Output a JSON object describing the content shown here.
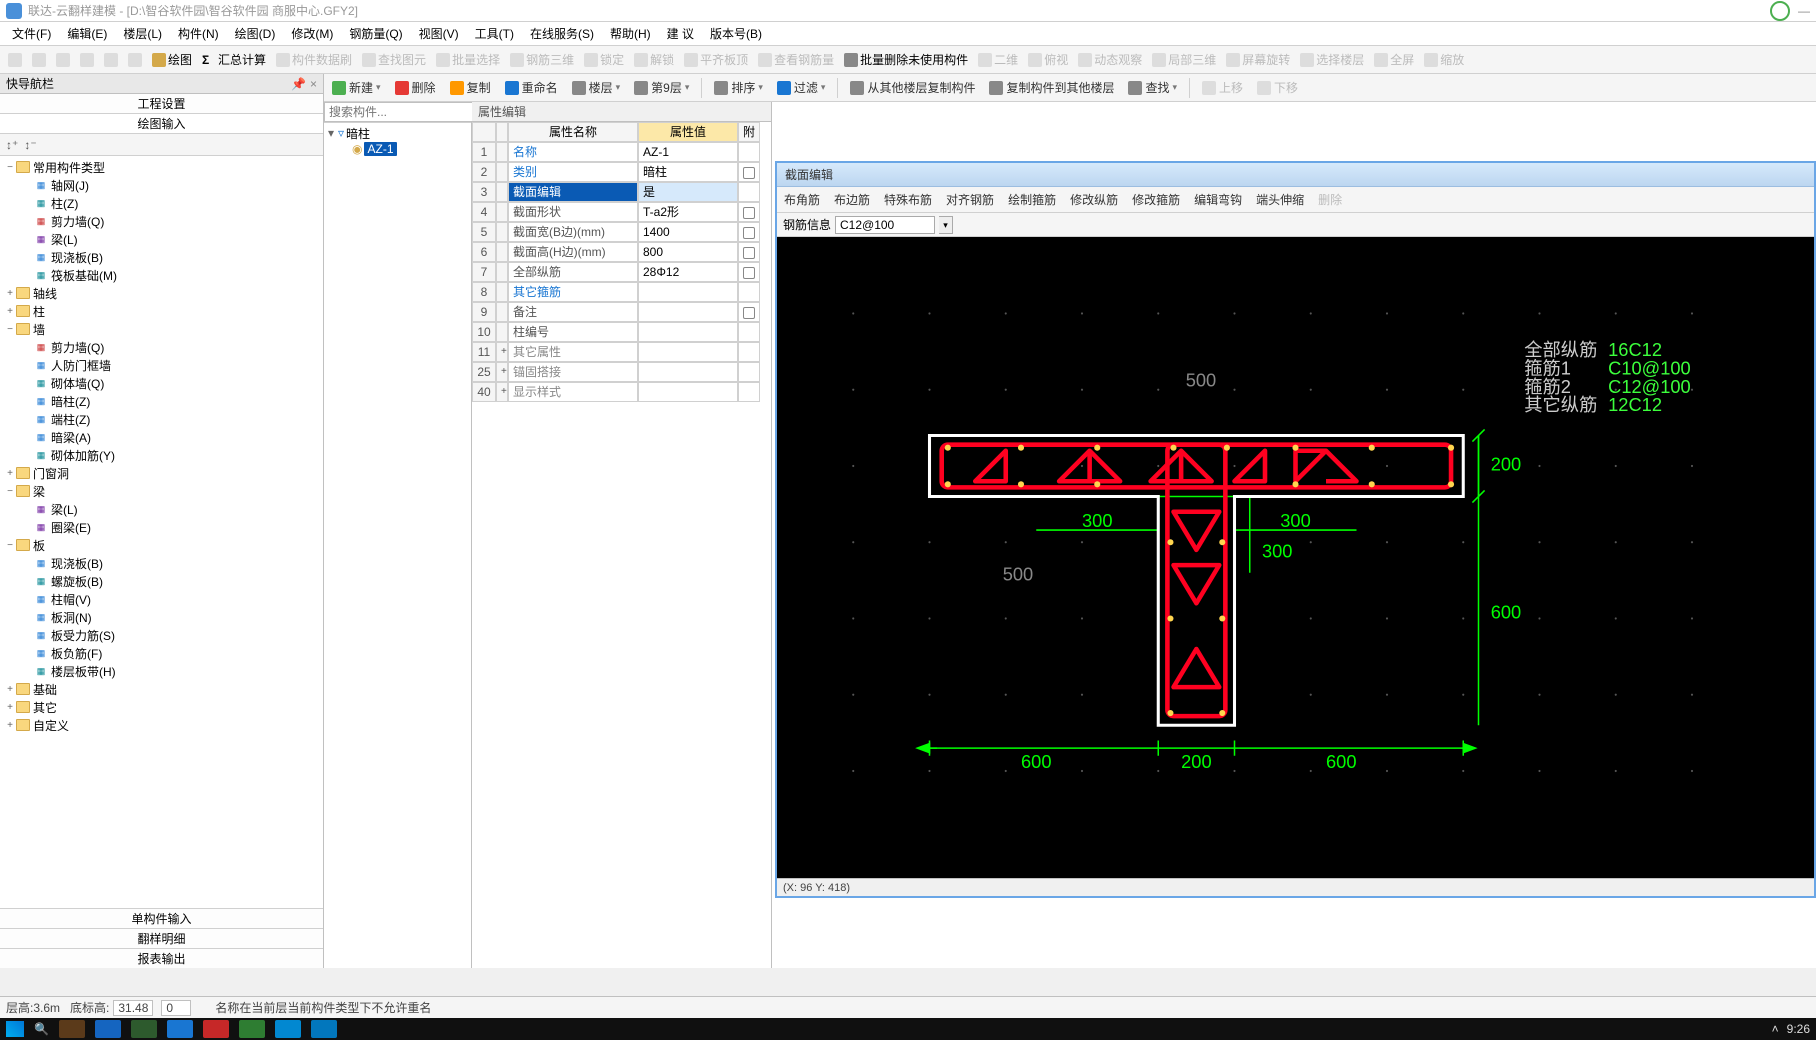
{
  "titlebar": {
    "text": "联达-云翻样建模 - [D:\\智谷软件园\\智谷软件园 商服中心.GFY2]"
  },
  "menu": [
    "文件(F)",
    "编辑(E)",
    "楼层(L)",
    "构件(N)",
    "绘图(D)",
    "修改(M)",
    "钢筋量(Q)",
    "视图(V)",
    "工具(T)",
    "在线服务(S)",
    "帮助(H)",
    "建 议",
    "版本号(B)"
  ],
  "toolbar": [
    {
      "l": "",
      "disabled": true
    },
    {
      "l": "",
      "disabled": true
    },
    {
      "l": "",
      "disabled": true
    },
    {
      "l": "",
      "disabled": true
    },
    {
      "l": "",
      "disabled": true
    },
    {
      "l": "",
      "disabled": true
    },
    {
      "l": "绘图",
      "bold": true,
      "icon": "pencil"
    },
    {
      "l": "汇总计算",
      "bold": true,
      "icon": "sigma"
    },
    {
      "l": "构件数据刷",
      "disabled": true
    },
    {
      "l": "查找图元",
      "disabled": true
    },
    {
      "l": "批量选择",
      "disabled": true
    },
    {
      "l": "钢筋三维",
      "disabled": true
    },
    {
      "l": "锁定",
      "disabled": true
    },
    {
      "l": "解锁",
      "disabled": true
    },
    {
      "l": "平齐板顶",
      "disabled": true
    },
    {
      "l": "查看钢筋量",
      "disabled": true
    },
    {
      "l": "批量删除未使用构件",
      "bold": true
    },
    {
      "l": "二维",
      "disabled": true
    },
    {
      "l": "俯视",
      "disabled": true
    },
    {
      "l": "动态观察",
      "disabled": true
    },
    {
      "l": "局部三维",
      "disabled": true
    },
    {
      "l": "屏幕旋转",
      "disabled": true
    },
    {
      "l": "选择楼层",
      "disabled": true
    },
    {
      "l": "全屏",
      "disabled": true
    },
    {
      "l": "缩放",
      "disabled": true
    }
  ],
  "subtoolbar": {
    "items": [
      "新建",
      "删除",
      "复制",
      "重命名",
      "楼层",
      "第9层",
      "",
      "排序",
      "过滤",
      "",
      "从其他楼层复制构件",
      "复制构件到其他楼层",
      "查找"
    ],
    "disabled": [
      "上移",
      "下移"
    ]
  },
  "left": {
    "nav_title": "快导航栏",
    "tab1": "工程设置",
    "tab2": "绘图输入",
    "tree": [
      {
        "d": 0,
        "t": "folder",
        "tw": "−",
        "l": "常用构件类型"
      },
      {
        "d": 1,
        "t": "node",
        "ic": "ic-blue",
        "l": "轴网(J)"
      },
      {
        "d": 1,
        "t": "node",
        "ic": "ic-teal",
        "l": "柱(Z)"
      },
      {
        "d": 1,
        "t": "node",
        "ic": "ic-red",
        "l": "剪力墙(Q)"
      },
      {
        "d": 1,
        "t": "node",
        "ic": "ic-purple",
        "l": "梁(L)"
      },
      {
        "d": 1,
        "t": "node",
        "ic": "ic-blue",
        "l": "现浇板(B)"
      },
      {
        "d": 1,
        "t": "node",
        "ic": "ic-teal",
        "l": "筏板基础(M)"
      },
      {
        "d": 0,
        "t": "folder",
        "tw": "+",
        "l": "轴线"
      },
      {
        "d": 0,
        "t": "folder",
        "tw": "+",
        "l": "柱"
      },
      {
        "d": 0,
        "t": "folder",
        "tw": "−",
        "l": "墙"
      },
      {
        "d": 1,
        "t": "node",
        "ic": "ic-red",
        "l": "剪力墙(Q)"
      },
      {
        "d": 1,
        "t": "node",
        "ic": "ic-blue",
        "l": "人防门框墙"
      },
      {
        "d": 1,
        "t": "node",
        "ic": "ic-teal",
        "l": "砌体墙(Q)"
      },
      {
        "d": 1,
        "t": "node",
        "ic": "ic-blue",
        "l": "暗柱(Z)"
      },
      {
        "d": 1,
        "t": "node",
        "ic": "ic-blue",
        "l": "端柱(Z)"
      },
      {
        "d": 1,
        "t": "node",
        "ic": "ic-blue",
        "l": "暗梁(A)"
      },
      {
        "d": 1,
        "t": "node",
        "ic": "ic-teal",
        "l": "砌体加筋(Y)"
      },
      {
        "d": 0,
        "t": "folder",
        "tw": "+",
        "l": "门窗洞"
      },
      {
        "d": 0,
        "t": "folder",
        "tw": "−",
        "l": "梁"
      },
      {
        "d": 1,
        "t": "node",
        "ic": "ic-purple",
        "l": "梁(L)"
      },
      {
        "d": 1,
        "t": "node",
        "ic": "ic-purple",
        "l": "圈梁(E)"
      },
      {
        "d": 0,
        "t": "folder",
        "tw": "−",
        "l": "板"
      },
      {
        "d": 1,
        "t": "node",
        "ic": "ic-blue",
        "l": "现浇板(B)"
      },
      {
        "d": 1,
        "t": "node",
        "ic": "ic-teal",
        "l": "螺旋板(B)"
      },
      {
        "d": 1,
        "t": "node",
        "ic": "ic-blue",
        "l": "柱帽(V)"
      },
      {
        "d": 1,
        "t": "node",
        "ic": "ic-blue",
        "l": "板洞(N)"
      },
      {
        "d": 1,
        "t": "node",
        "ic": "ic-blue",
        "l": "板受力筋(S)"
      },
      {
        "d": 1,
        "t": "node",
        "ic": "ic-blue",
        "l": "板负筋(F)"
      },
      {
        "d": 1,
        "t": "node",
        "ic": "ic-teal",
        "l": "楼层板带(H)"
      },
      {
        "d": 0,
        "t": "folder",
        "tw": "+",
        "l": "基础"
      },
      {
        "d": 0,
        "t": "folder",
        "tw": "+",
        "l": "其它"
      },
      {
        "d": 0,
        "t": "folder",
        "tw": "+",
        "l": "自定义"
      }
    ],
    "bottom_tabs": [
      "单构件输入",
      "翻样明细",
      "报表输出"
    ]
  },
  "mid": {
    "search_ph": "搜索构件...",
    "root": "暗柱",
    "child": "AZ-1"
  },
  "prop": {
    "title": "属性编辑",
    "hdr_name": "属性名称",
    "hdr_val": "属性值",
    "hdr_att": "附",
    "rows": [
      {
        "n": "1",
        "name": "名称",
        "val": "AZ-1",
        "chk": false,
        "blue": true
      },
      {
        "n": "2",
        "name": "类别",
        "val": "暗柱",
        "chk": true,
        "blue": true
      },
      {
        "n": "3",
        "name": "截面编辑",
        "val": "是",
        "chk": false,
        "sel": true,
        "blue": true
      },
      {
        "n": "4",
        "name": "截面形状",
        "val": "T-a2形",
        "chk": true,
        "blue": false
      },
      {
        "n": "5",
        "name": "截面宽(B边)(mm)",
        "val": "1400",
        "chk": true,
        "blue": false
      },
      {
        "n": "6",
        "name": "截面高(H边)(mm)",
        "val": "800",
        "chk": true,
        "blue": false
      },
      {
        "n": "7",
        "name": "全部纵筋",
        "val": "28Φ12",
        "chk": true,
        "blue": false
      },
      {
        "n": "8",
        "name": "其它箍筋",
        "val": "",
        "chk": false,
        "blue": true
      },
      {
        "n": "9",
        "name": "备注",
        "val": "",
        "chk": true,
        "blue": false
      },
      {
        "n": "10",
        "name": "柱编号",
        "val": "",
        "chk": false,
        "blue": false
      },
      {
        "n": "11",
        "plus": "+",
        "name": "其它属性",
        "val": "",
        "chk": false,
        "blue": false,
        "gray": true
      },
      {
        "n": "25",
        "plus": "+",
        "name": "锚固搭接",
        "val": "",
        "chk": false,
        "blue": false,
        "gray": true
      },
      {
        "n": "40",
        "plus": "+",
        "name": "显示样式",
        "val": "",
        "chk": false,
        "blue": false,
        "gray": true
      }
    ]
  },
  "section": {
    "title": "截面编辑",
    "tabs": [
      "布角筋",
      "布边筋",
      "特殊布筋",
      "对齐钢筋",
      "绘制箍筋",
      "修改纵筋",
      "修改箍筋",
      "编辑弯钩",
      "端头伸缩"
    ],
    "tab_del": "删除",
    "rebar_label": "钢筋信息",
    "rebar_val": "C12@100",
    "legend": [
      {
        "l": "全部纵筋",
        "v": "16C12",
        "c": "#3cff3c"
      },
      {
        "l": "箍筋1",
        "v": "C10@100",
        "c": "#3cff3c"
      },
      {
        "l": "箍筋2",
        "v": "C12@100",
        "c": "#3cff3c"
      },
      {
        "l": "其它纵筋",
        "v": "12C12",
        "c": "#3cff3c"
      }
    ],
    "dims": {
      "top_h": "200",
      "mid_w": "600",
      "mid_h": "600",
      "stem_w": "200",
      "flange_side": "300",
      "flange_inner": "300",
      "bot_side": "600",
      "bot_mid": "200",
      "grid": "500"
    },
    "coord": "(X: 96 Y: 418)"
  },
  "status": {
    "h_label": "层高:",
    "h_val": "3.6m",
    "b_label": "底标高:",
    "b_val": "31.48",
    "extra": "0",
    "msg": "名称在当前层当前构件类型下不允许重名"
  },
  "clock": "9:26"
}
